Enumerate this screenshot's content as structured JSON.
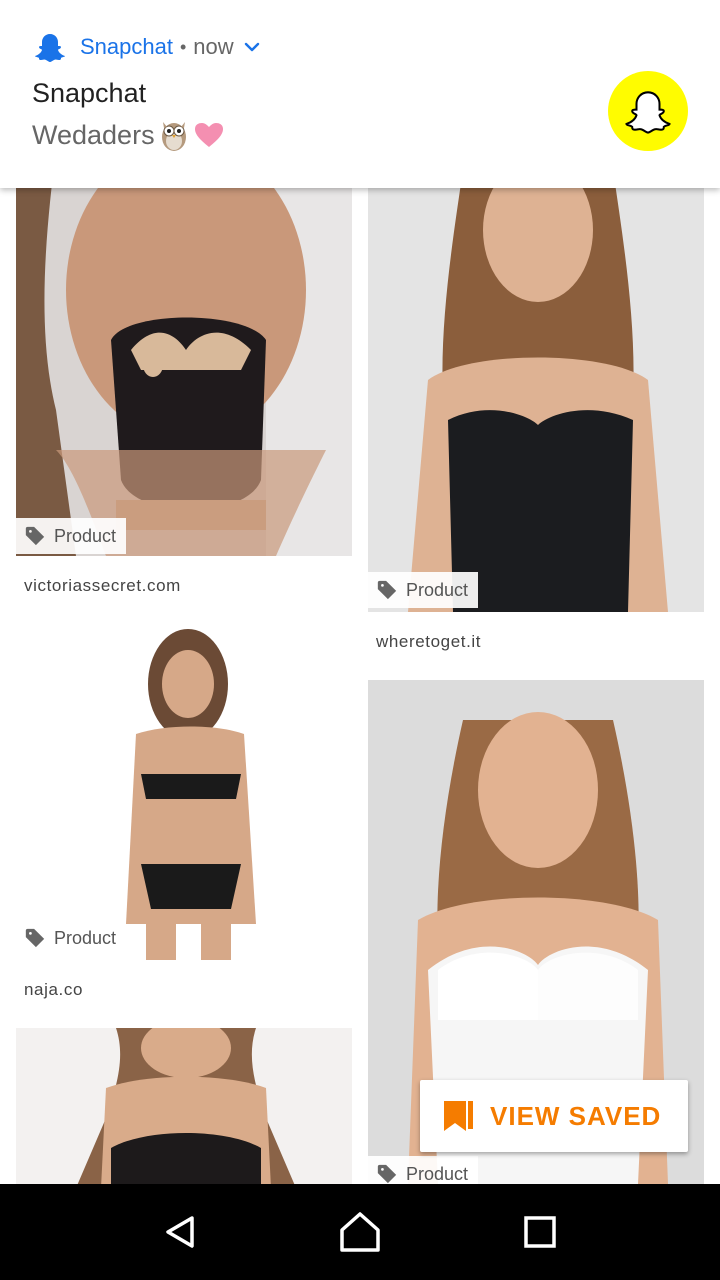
{
  "notification": {
    "app_name": "Snapchat",
    "separator": "•",
    "time": "now",
    "title": "Snapchat",
    "text": "Wedaders",
    "emoji": [
      "owl",
      "pink-heart"
    ],
    "icons": {
      "app": "snapchat-ghost-icon",
      "expand": "chevron-down-icon",
      "badge": "snapchat-ghost-icon"
    },
    "colors": {
      "accent": "#1a73e8",
      "snap_yellow": "#fffc00"
    }
  },
  "feed": {
    "left_column": [
      {
        "tag_label": "Product",
        "source": "victoriassecret.com"
      },
      {
        "tag_label": "Product",
        "source": "naja.co"
      }
    ],
    "right_column": [
      {
        "tag_label": "Product",
        "source": "wheretoget.it"
      },
      {
        "tag_label": "Product",
        "source": ""
      }
    ]
  },
  "view_saved": {
    "label": "VIEW SAVED",
    "icon": "bookmark-icon",
    "color": "#f57c00"
  },
  "navbar": {
    "buttons": [
      "back-icon",
      "home-icon",
      "recents-icon"
    ]
  }
}
